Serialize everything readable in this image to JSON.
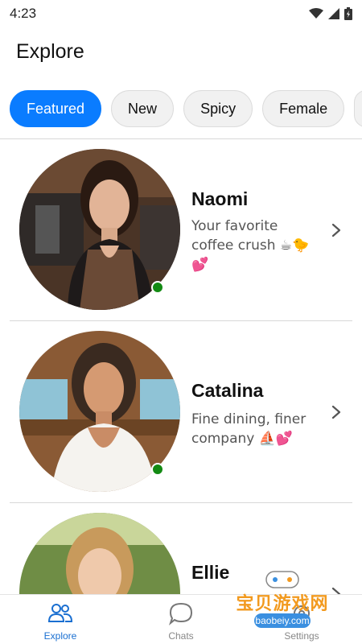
{
  "status_bar": {
    "time": "4:23"
  },
  "page": {
    "title": "Explore"
  },
  "chips": [
    {
      "label": "Featured",
      "active": true
    },
    {
      "label": "New",
      "active": false
    },
    {
      "label": "Spicy",
      "active": false
    },
    {
      "label": "Female",
      "active": false
    }
  ],
  "cards": [
    {
      "name": "Naomi",
      "description": "Your favorite coffee crush ☕🐤💕",
      "online": true
    },
    {
      "name": "Catalina",
      "description": "Fine dining, finer company ⛵💕",
      "online": true
    },
    {
      "name": "Ellie",
      "description": "",
      "online": false
    }
  ],
  "bottom_nav": [
    {
      "label": "Explore",
      "icon": "people-icon",
      "active": true
    },
    {
      "label": "Chats",
      "icon": "chat-bubble-icon",
      "active": false
    },
    {
      "label": "Settings",
      "icon": "gear-icon",
      "active": false
    }
  ],
  "watermark": {
    "text": "宝贝游戏网",
    "url": "baobeiy.com"
  },
  "colors": {
    "accent": "#0a7cff",
    "online": "#138a13",
    "nav_active": "#1a6fd1"
  }
}
